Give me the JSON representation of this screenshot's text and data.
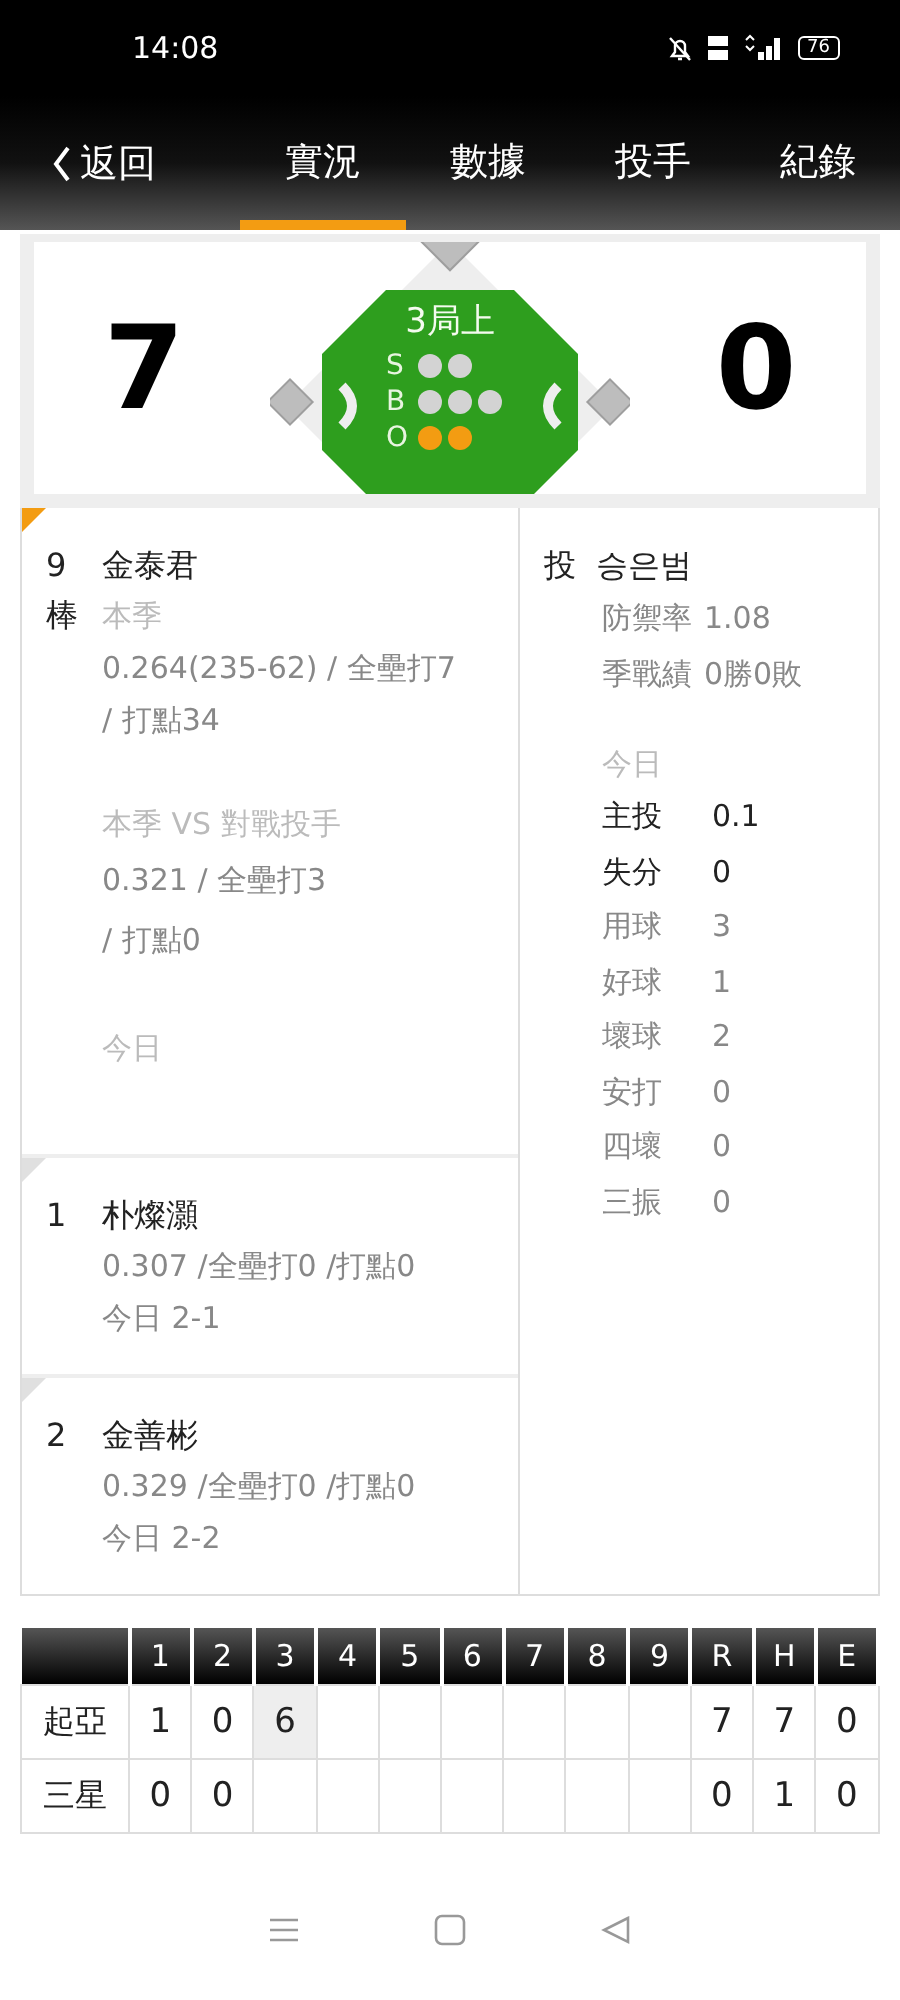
{
  "status_bar": {
    "time": "14:08",
    "battery": "76"
  },
  "nav": {
    "back": "返回",
    "tabs": [
      {
        "label": "實況",
        "selected": true
      },
      {
        "label": "數據",
        "selected": false
      },
      {
        "label": "投手",
        "selected": false
      },
      {
        "label": "紀錄",
        "selected": false
      }
    ]
  },
  "scoreboard": {
    "away_score": "7",
    "home_score": "0",
    "inning": "3局上",
    "count": [
      {
        "label": "S",
        "dots": [
          {
            "on": false
          },
          {
            "on": false
          }
        ]
      },
      {
        "label": "B",
        "dots": [
          {
            "on": false
          },
          {
            "on": false
          },
          {
            "on": false
          }
        ]
      },
      {
        "label": "O",
        "dots": [
          {
            "on": true
          },
          {
            "on": true
          }
        ]
      }
    ]
  },
  "batters": [
    {
      "order": "9",
      "role": "棒",
      "current": true,
      "name": "金泰君",
      "season_label": "本季",
      "season_lines": [
        "0.264(235-62) / 全壘打7",
        "/ 打點34"
      ],
      "vs_label": "本季 VS 對戰投手",
      "vs_lines": [
        "0.321 / 全壘打3",
        "/ 打點0"
      ],
      "today_label": "今日"
    },
    {
      "order": "1",
      "current": false,
      "name": "朴燦灝",
      "stats": "0.307 /全壘打0 /打點0",
      "today": "今日 2-1"
    },
    {
      "order": "2",
      "current": false,
      "name": "金善彬",
      "stats": "0.329 /全壘打0 /打點0",
      "today": "今日 2-2"
    }
  ],
  "pitcher": {
    "role": "投",
    "name": "승은범",
    "era_label": "防禦率",
    "era": "1.08",
    "record_label": "季戰績",
    "record": "0勝0敗",
    "today_label": "今日",
    "stats": [
      {
        "label": "主投",
        "value": "0.1",
        "emphasis": true
      },
      {
        "label": "失分",
        "value": "0",
        "emphasis": true
      },
      {
        "label": "用球",
        "value": "3",
        "emphasis": false
      },
      {
        "label": "好球",
        "value": "1",
        "emphasis": false
      },
      {
        "label": "壞球",
        "value": "2",
        "emphasis": false
      },
      {
        "label": "安打",
        "value": "0",
        "emphasis": false
      },
      {
        "label": "四壞",
        "value": "0",
        "emphasis": false
      },
      {
        "label": "三振",
        "value": "0",
        "emphasis": false
      }
    ]
  },
  "linescore": {
    "columns": [
      "1",
      "2",
      "3",
      "4",
      "5",
      "6",
      "7",
      "8",
      "9",
      "R",
      "H",
      "E"
    ],
    "rows": [
      {
        "team": "起亞",
        "cells": [
          {
            "value": "1",
            "current": false
          },
          {
            "value": "0",
            "current": false
          },
          {
            "value": "6",
            "current": true
          },
          {
            "current": false
          },
          {
            "current": false
          },
          {
            "current": false
          },
          {
            "current": false
          },
          {
            "current": false
          },
          {
            "current": false
          },
          {
            "value": "7",
            "current": false
          },
          {
            "value": "7",
            "current": false
          },
          {
            "value": "0",
            "current": false
          }
        ]
      },
      {
        "team": "三星",
        "cells": [
          {
            "value": "0",
            "current": false
          },
          {
            "value": "0",
            "current": false
          },
          {
            "current": false
          },
          {
            "current": false
          },
          {
            "current": false
          },
          {
            "current": false
          },
          {
            "current": false
          },
          {
            "current": false
          },
          {
            "current": false
          },
          {
            "value": "0",
            "current": false
          },
          {
            "value": "1",
            "current": false
          },
          {
            "value": "0",
            "current": false
          }
        ]
      }
    ]
  }
}
